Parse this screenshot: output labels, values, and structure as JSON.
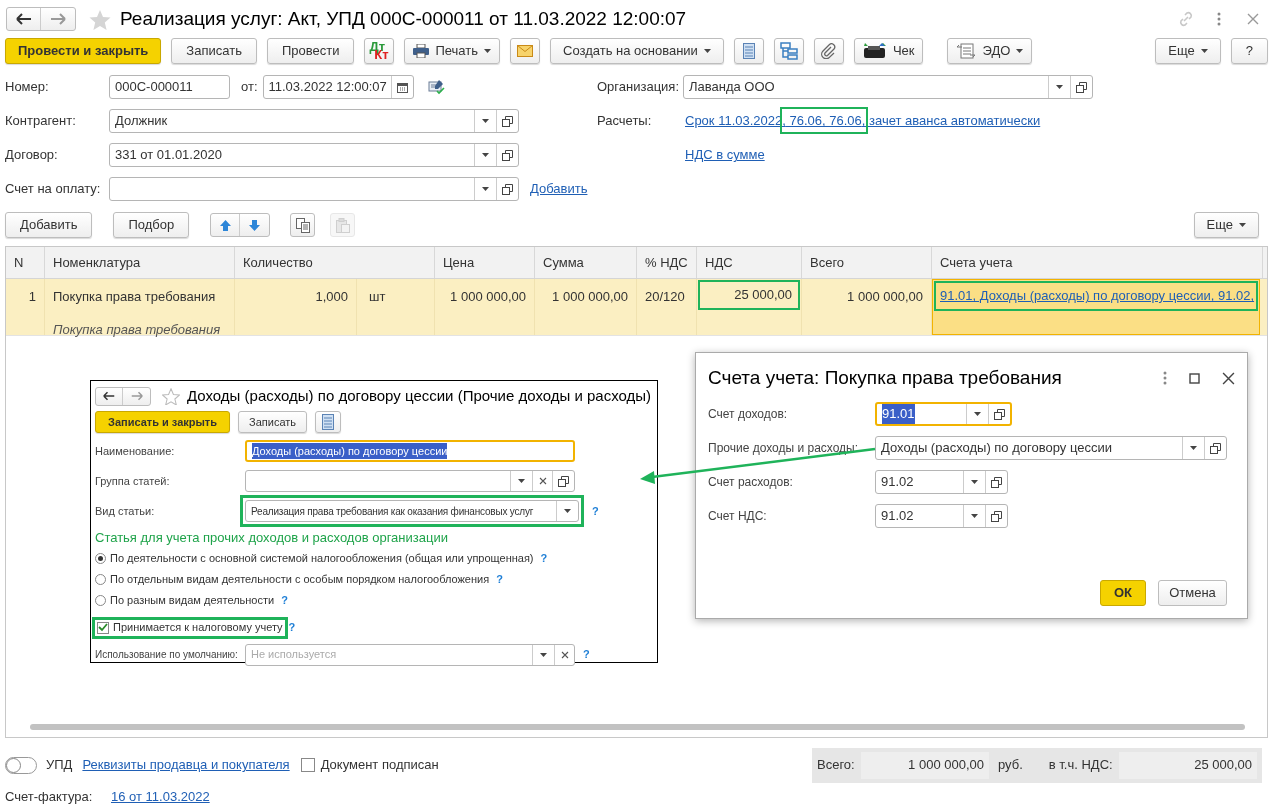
{
  "window": {
    "title": "Реализация услуг: Акт, УПД 000С-000011 от 11.03.2022 12:00:07"
  },
  "toolbar": [
    {
      "kind": "primary",
      "label": "Провести и закрыть"
    },
    {
      "kind": "button",
      "label": "Записать"
    },
    {
      "kind": "button",
      "label": "Провести"
    },
    {
      "kind": "dtkt",
      "top": "Дт",
      "bottom": "Кт"
    },
    {
      "kind": "print",
      "label": "Печать"
    },
    {
      "kind": "mail"
    },
    {
      "kind": "dropdown",
      "label": "Создать на основании"
    },
    {
      "kind": "list"
    },
    {
      "kind": "structure"
    },
    {
      "kind": "clip"
    },
    {
      "kind": "receipt",
      "label": "Чек"
    },
    {
      "kind": "edo",
      "label": "ЭДО"
    }
  ],
  "toolbar_right": [
    {
      "kind": "dropdown",
      "label": "Еще"
    },
    {
      "kind": "button",
      "label": "?"
    }
  ],
  "header": {
    "number": {
      "label": "Номер:",
      "value": "000С-000011"
    },
    "date": {
      "label": "от:",
      "value": "11.03.2022 12:00:07"
    },
    "organization": {
      "label": "Организация:",
      "value": "Лаванда ООО"
    },
    "counterparty": {
      "label": "Контрагент:",
      "value": "Должник"
    },
    "settlements": {
      "label": "Расчеты:",
      "link_parts": [
        {
          "text": "Срок 11.03.2022,",
          "highlighted": false
        },
        {
          "text": " 76.06, 76.06",
          "highlighted": true
        },
        {
          "text": ", зачет аванса автоматически",
          "highlighted": false
        }
      ]
    },
    "contract": {
      "label": "Договор:",
      "value": "331 от 01.01.2020"
    },
    "vat_link": "НДС в сумме",
    "payment_invoice": {
      "label": "Счет на оплату:",
      "link": "Добавить"
    }
  },
  "table_toolbar": {
    "add": "Добавить",
    "pick": "Подбор",
    "paste_disabled": true,
    "more": "Еще"
  },
  "table": {
    "columns": [
      "N",
      "Номенклатура",
      "Количество",
      "Цена",
      "Сумма",
      "% НДС",
      "НДС",
      "Всего",
      "Счета учета"
    ],
    "rows": [
      {
        "n": "1",
        "name": "Покупка права требования",
        "name_sub": "Покупка права требования",
        "quantity": "1,000",
        "unit": "шт",
        "price": "1 000 000,00",
        "sum": "1 000 000,00",
        "vat_rate": "20/120",
        "vat": "25 000,00",
        "vat_highlighted": true,
        "total": "1 000 000,00",
        "accounts": "91.01, Доходы (расходы) по договору цессии, 91.02,",
        "accounts_highlighted": true,
        "selected": true
      }
    ]
  },
  "inner_form": {
    "title": "Доходы (расходы) по договору цессии (Прочие доходы и расходы)",
    "buttons": [
      {
        "kind": "primary",
        "label": "Записать и закрыть"
      },
      {
        "kind": "button",
        "label": "Записать"
      },
      {
        "kind": "list"
      }
    ],
    "name": {
      "label": "Наименование:",
      "value": "Доходы (расходы) по договору цессии",
      "focused": true
    },
    "group": {
      "label": "Группа статей:"
    },
    "item_type": {
      "label": "Вид статьи:",
      "value": "Реализация права требования как оказания финансовых услуг",
      "help": "?",
      "highlighted": true
    },
    "section_title": "Статья для учета прочих доходов и расходов организации",
    "options": [
      {
        "label": "По деятельности с основной системой налогообложения (общая или упрощенная)",
        "help": "?",
        "selected": true
      },
      {
        "label": "По отдельным видам деятельности с особым порядком налогообложения",
        "help": "?",
        "selected": false
      },
      {
        "label": "По разным видам деятельности",
        "help": "?",
        "selected": false
      }
    ],
    "tax_accounting": {
      "label": "Принимается к налоговому учету",
      "checked": true,
      "help": "?",
      "highlighted": true
    },
    "default_use": {
      "label": "Использование по умолчанию:",
      "placeholder": "Не используется",
      "help": "?"
    }
  },
  "dialog": {
    "title": "Счета учета: Покупка права требования",
    "fields": [
      {
        "label": "Счет доходов:",
        "value": "91.01",
        "focused": true,
        "wide": false
      },
      {
        "label": "Прочие доходы и расходы:",
        "value": "Доходы (расходы) по договору цессии",
        "focused": false,
        "wide": true
      },
      {
        "label": "Счет расходов:",
        "value": "91.02",
        "focused": false,
        "wide": false
      },
      {
        "label": "Счет НДС:",
        "value": "91.02",
        "focused": false,
        "wide": false
      }
    ],
    "ok": "ОК",
    "cancel": "Отмена"
  },
  "footer": {
    "upd_toggle": {
      "label": "УПД",
      "on": false
    },
    "requisites_link": "Реквизиты продавца и покупателя",
    "signed": {
      "label": "Документ подписан",
      "checked": false
    },
    "total_label": "Всего:",
    "total": "1 000 000,00",
    "currency": "руб.",
    "vat_label": "в т.ч. НДС:",
    "vat": "25 000,00",
    "invoice_label": "Счет-фактура:",
    "invoice_link": "16 от 11.03.2022"
  }
}
